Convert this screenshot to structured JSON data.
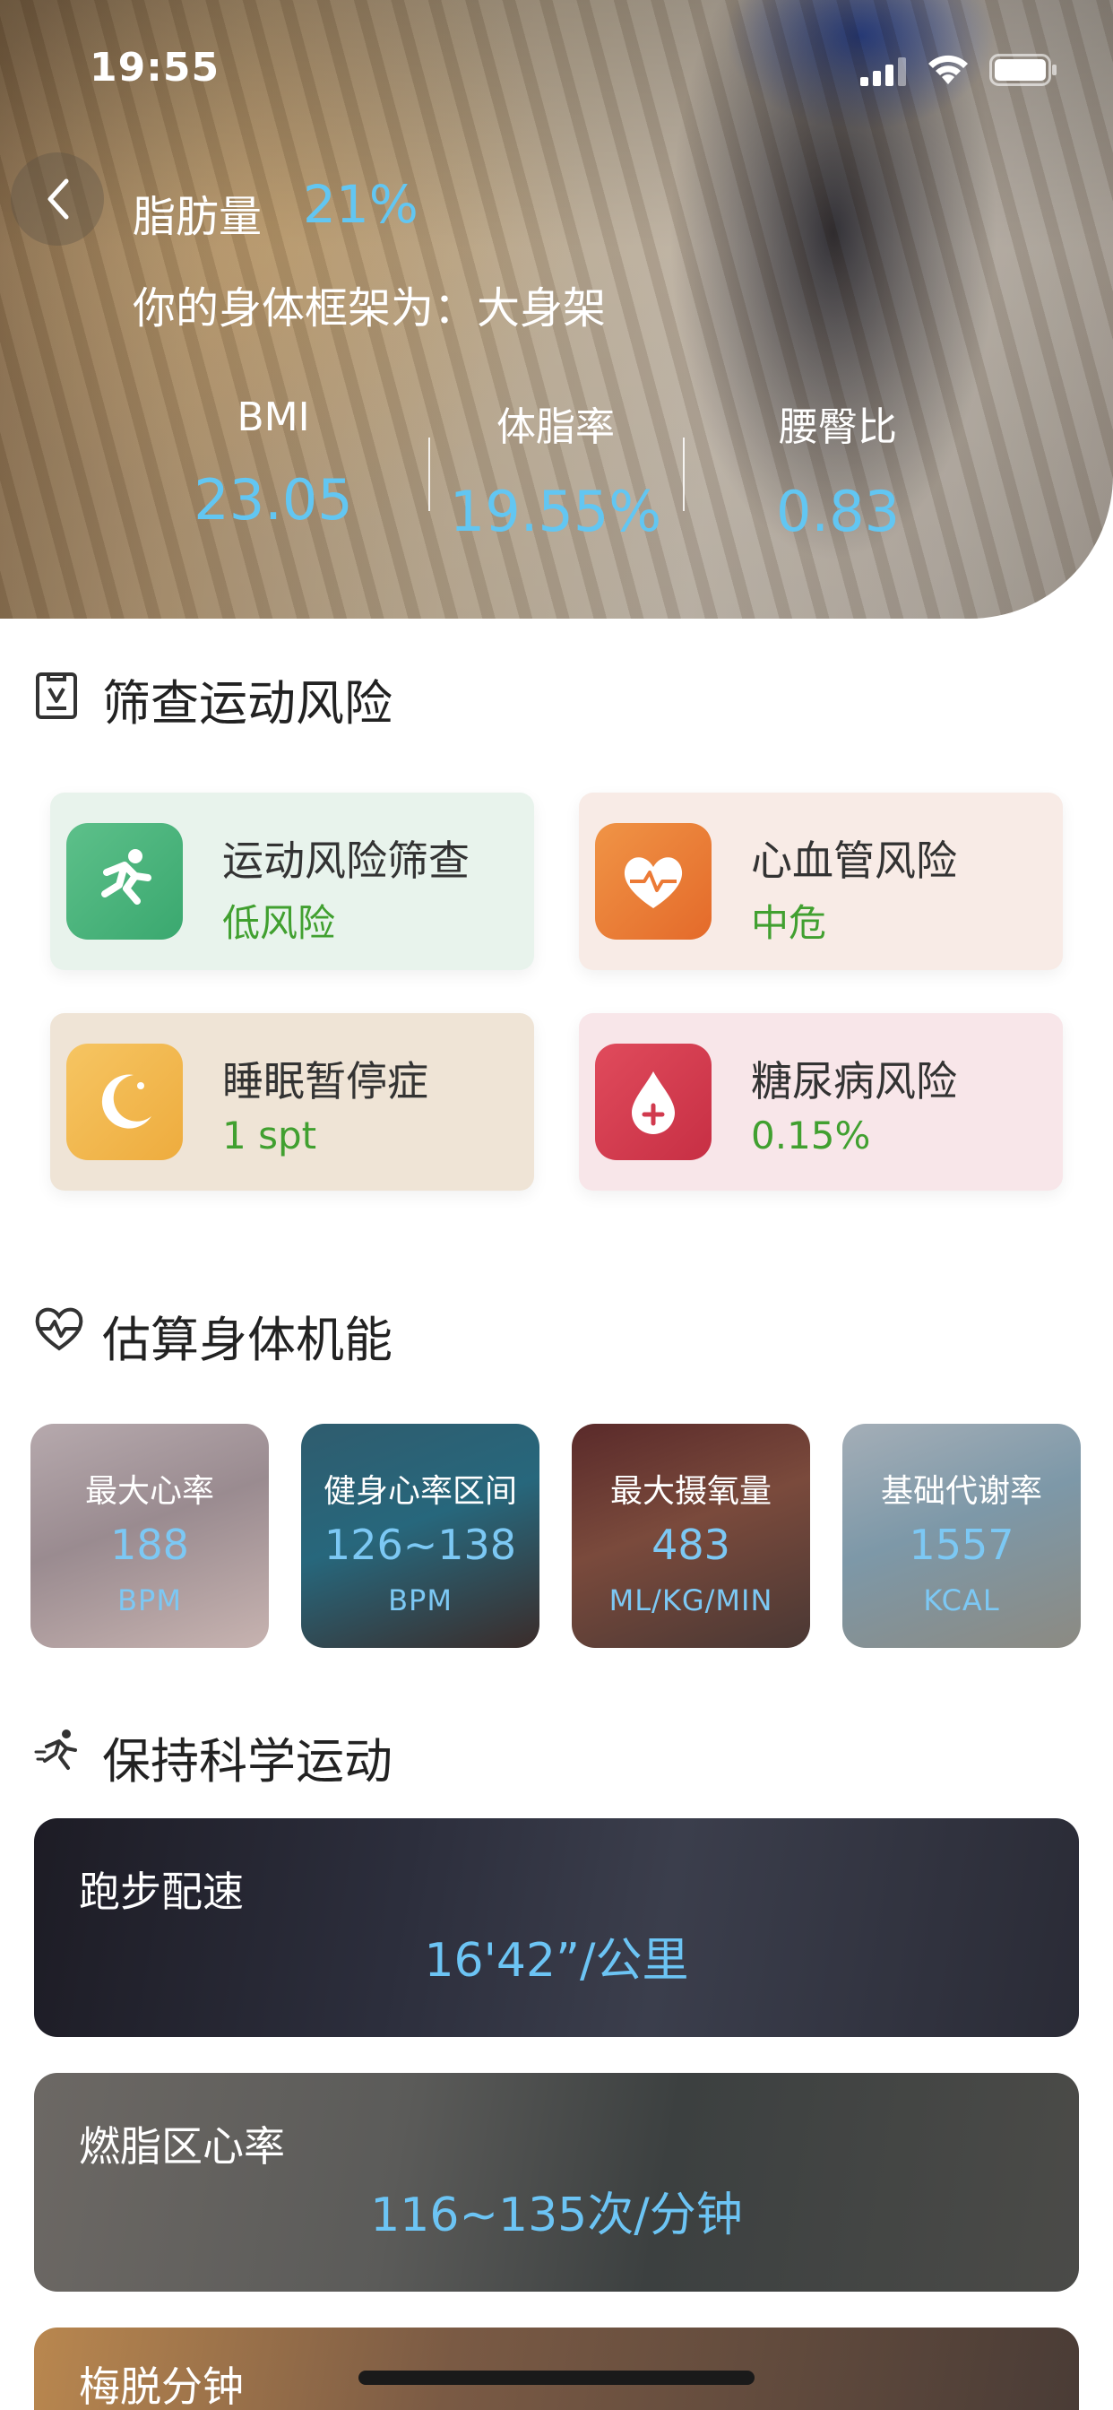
{
  "status_bar": {
    "time": "19:55"
  },
  "header": {
    "fat_label": "脂肪量",
    "fat_value": "21%",
    "frame_text": "你的身体框架为：大身架",
    "metrics": [
      {
        "label": "BMI",
        "value": "23.05"
      },
      {
        "label": "体脂率",
        "value": "19.55%"
      },
      {
        "label": "腰臀比",
        "value": "0.83"
      }
    ]
  },
  "screening": {
    "title": "筛查运动风险",
    "cards": [
      {
        "name": "运动风险筛查",
        "value": "低风险",
        "icon": "running-person-icon"
      },
      {
        "name": "心血管风险",
        "value": "中危",
        "icon": "heart-pulse-icon"
      },
      {
        "name": "睡眠暂停症",
        "value": "1 spt",
        "icon": "moon-icon"
      },
      {
        "name": "糖尿病风险",
        "value": "0.15%",
        "icon": "blood-drop-plus-icon"
      }
    ]
  },
  "function": {
    "title": "估算身体机能",
    "cards": [
      {
        "title": "最大心率",
        "value": "188",
        "unit": "BPM"
      },
      {
        "title": "健身心率区间",
        "value": "126~138",
        "unit": "BPM"
      },
      {
        "title": "最大摄氧量",
        "value": "483",
        "unit": "ML/KG/MIN"
      },
      {
        "title": "基础代谢率",
        "value": "1557",
        "unit": "KCAL"
      }
    ]
  },
  "sport": {
    "title": "保持科学运动",
    "cards": [
      {
        "title": "跑步配速",
        "value": "16'42”/公里"
      },
      {
        "title": "燃脂区心率",
        "value": "116~135次/分钟"
      },
      {
        "title": "梅脱分钟",
        "value": ""
      }
    ]
  }
}
